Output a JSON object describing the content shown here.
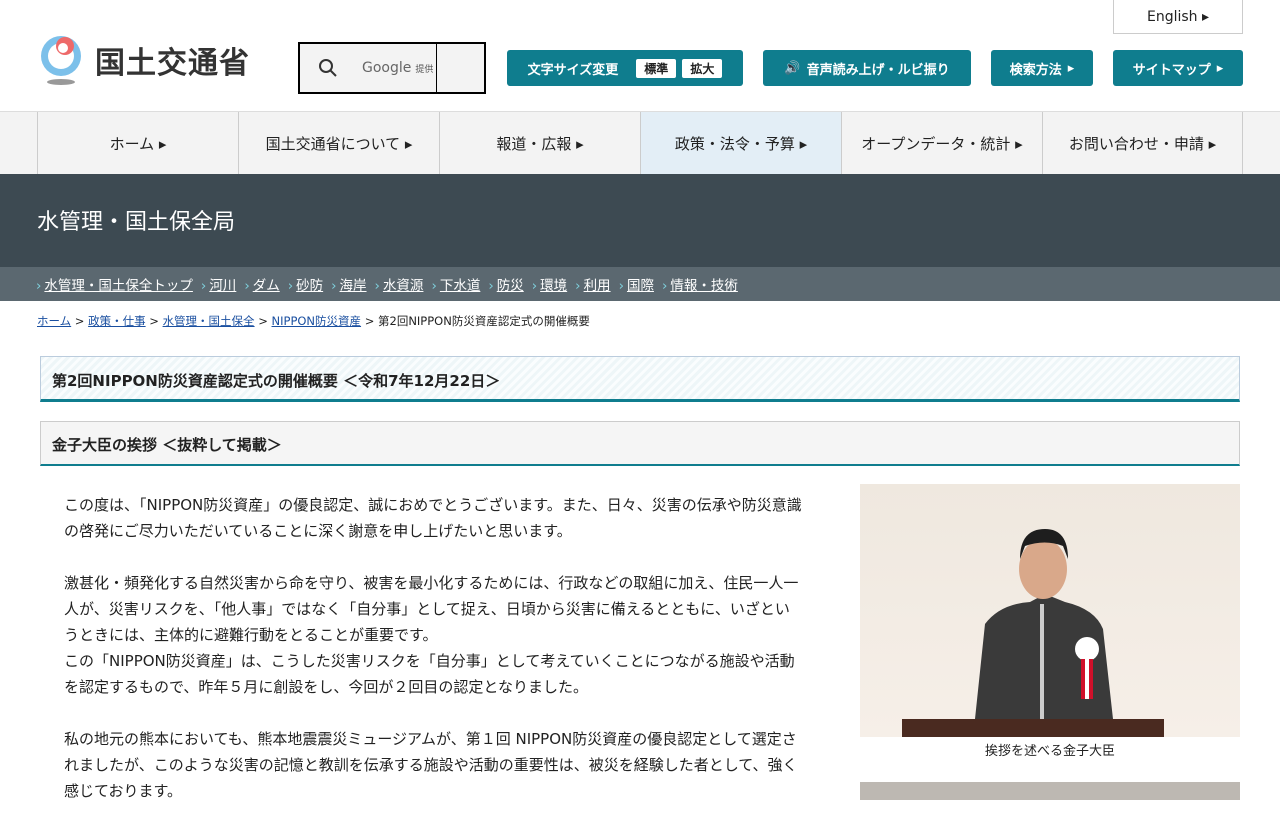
{
  "header": {
    "logo_text": "国土交通省",
    "search_brand": "Google",
    "search_provided": "提供",
    "english": "English",
    "font_size": {
      "label": "文字サイズ変更",
      "standard": "標準",
      "large": "拡大"
    },
    "speech": "音声読み上げ・ルビ振り",
    "search_method": "検索方法",
    "sitemap": "サイトマップ"
  },
  "global_nav": [
    "ホーム",
    "国土交通省について",
    "報道・広報",
    "政策・法令・予算",
    "オープンデータ・統計",
    "お問い合わせ・申請"
  ],
  "section_title": "水管理・国土保全局",
  "sub_nav": [
    "水管理・国土保全トップ",
    "河川",
    "ダム",
    "砂防",
    "海岸",
    "水資源",
    "下水道",
    "防災",
    "環境",
    "利用",
    "国際",
    "情報・技術"
  ],
  "breadcrumb": [
    "ホーム",
    "政策・仕事",
    "水管理・国土保全",
    "NIPPON防災資産"
  ],
  "breadcrumb_current": "第2回NIPPON防災資産認定式の開催概要",
  "page_title": "第2回NIPPON防災資産認定式の開催概要 ＜令和7年12月22日＞",
  "subheading": "金子大臣の挨拶 ＜抜粋して掲載＞",
  "paragraphs": [
    "この度は、「NIPPON防災資産」の優良認定、誠におめでとうございます。また、日々、災害の伝承や防災意識の啓発にご尽力いただいていることに深く謝意を申し上げたいと思います。",
    "激甚化・頻発化する自然災害から命を守り、被害を最小化するためには、行政などの取組に加え、住民一人一人が、災害リスクを、「他人事」ではなく「自分事」として捉え、日頃から災害に備えるとともに、いざというときには、主体的に避難行動をとることが重要です。",
    "この「NIPPON防災資産」は、こうした災害リスクを「自分事」として考えていくことにつながる施設や活動を認定するもので、昨年５月に創設をし、今回が２回目の認定となりました。",
    "私の地元の熊本においても、熊本地震震災ミュージアムが、第１回 NIPPON防災資産の優良認定として選定されましたが、このような災害の記憶と教訓を伝承する施設や活動の重要性は、被災を経験した者として、強く感じております。"
  ],
  "photo_caption": "挨拶を述べる金子大臣"
}
